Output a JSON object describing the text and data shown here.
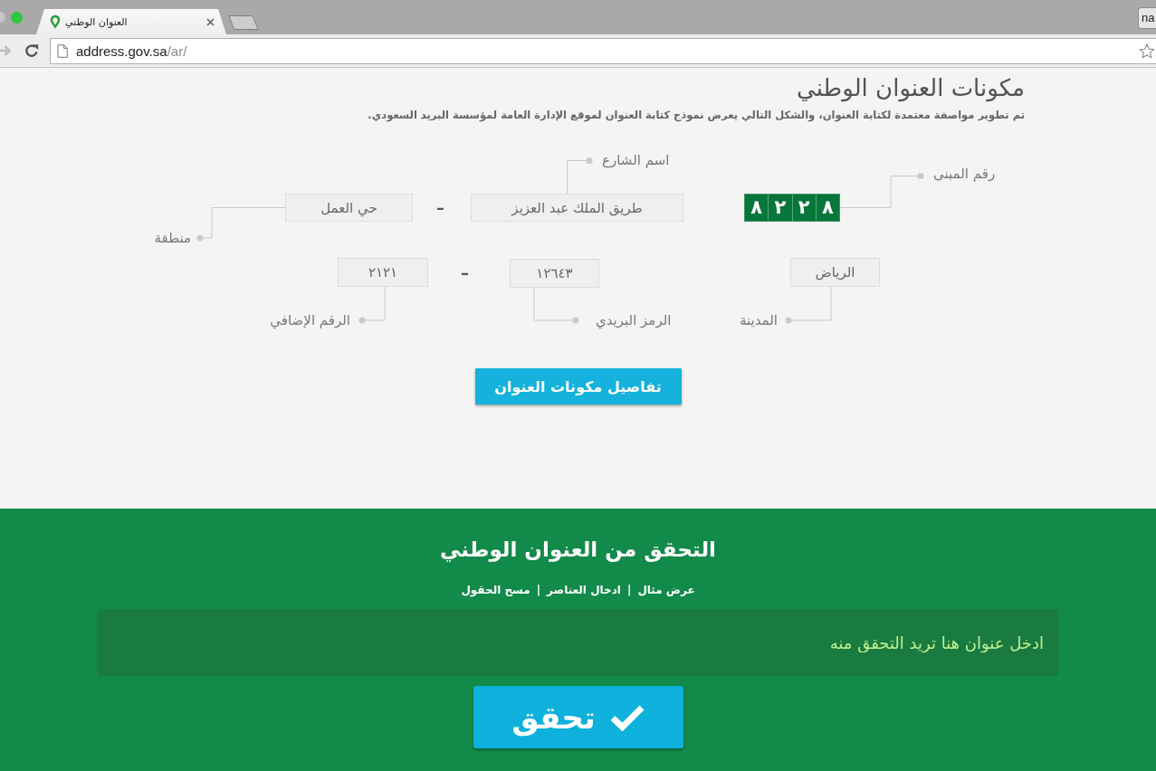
{
  "browser": {
    "tab": {
      "title": "العنوان الوطني"
    },
    "profile_button": "na",
    "url": {
      "host": "address.gov.sa",
      "path": "/ar/"
    }
  },
  "components": {
    "title": "مكونات العنوان الوطني",
    "description": "تم تطوير مواصفة معتمدة لكتابة العنوان، والشكل التالي يعرض نموذج كتابة العنوان لموقع الإدارة العامة لمؤسسة البريد السعودي.",
    "fields": [
      {
        "label": "رقم المبنى",
        "digits": [
          "٨",
          "٢",
          "٢",
          "٨"
        ],
        "kind": "digits"
      },
      {
        "label": "اسم الشارع",
        "value": "طريق الملك عبد العزيز",
        "kind": "text"
      },
      {
        "label": "منطقة",
        "value": "حي العمل",
        "kind": "text"
      },
      {
        "label": "المدينة",
        "value": "الرياض",
        "kind": "text"
      },
      {
        "label": "الرمز البريدي",
        "value": "١٢٦٤٣",
        "kind": "text"
      },
      {
        "label": "الرقم الإضافي",
        "value": "٢١٢١",
        "kind": "text"
      }
    ],
    "separators": [
      "–",
      "–"
    ],
    "details_button": "تفاصيل مكونات العنوان"
  },
  "verification": {
    "title": "التحقق من العنوان الوطني",
    "links": [
      {
        "label": "عرض مثال"
      },
      {
        "label": "ادخال العناصر"
      },
      {
        "label": "مسح الحقول"
      }
    ],
    "link_separators": [
      "|",
      "|"
    ],
    "input": {
      "placeholder": "ادخل عنوان هنا تريد التحقق منه"
    },
    "verify_button": "تحقق"
  }
}
